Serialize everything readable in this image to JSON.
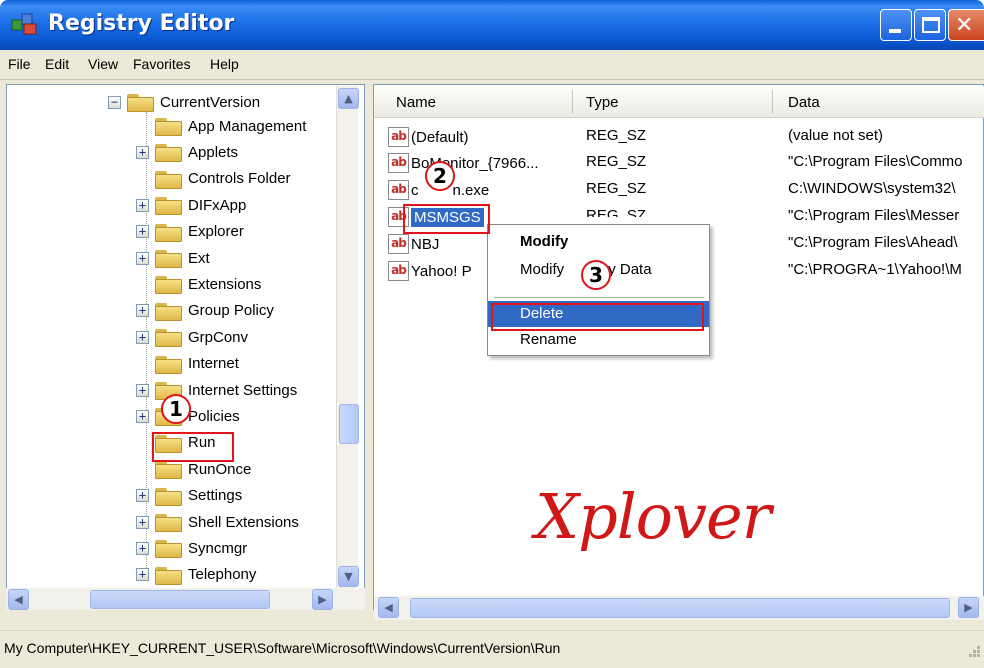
{
  "window": {
    "title": "Registry Editor"
  },
  "menu": [
    "File",
    "Edit",
    "View",
    "Favorites",
    "Help"
  ],
  "tree": {
    "items": [
      {
        "label": "CurrentVersion",
        "expander": "−"
      },
      {
        "label": "App Management",
        "expander": ""
      },
      {
        "label": "Applets",
        "expander": "+"
      },
      {
        "label": "Controls Folder",
        "expander": ""
      },
      {
        "label": "DIFxApp",
        "expander": "+"
      },
      {
        "label": "Explorer",
        "expander": "+"
      },
      {
        "label": "Ext",
        "expander": "+"
      },
      {
        "label": "Extensions",
        "expander": ""
      },
      {
        "label": "Group Policy",
        "expander": "+"
      },
      {
        "label": "GrpConv",
        "expander": "+"
      },
      {
        "label": "Internet",
        "expander": ""
      },
      {
        "label": "Internet Settings",
        "expander": "+"
      },
      {
        "label": "Policies",
        "expander": "+"
      },
      {
        "label": "Run",
        "expander": ""
      },
      {
        "label": "RunOnce",
        "expander": ""
      },
      {
        "label": "Settings",
        "expander": "+"
      },
      {
        "label": "Shell Extensions",
        "expander": "+"
      },
      {
        "label": "Syncmgr",
        "expander": "+"
      },
      {
        "label": "Telephony",
        "expander": "+"
      }
    ],
    "selected": "Run"
  },
  "list": {
    "columns": [
      "Name",
      "Type",
      "Data"
    ],
    "rows": [
      {
        "name": "(Default)",
        "type": "REG_SZ",
        "data": "(value not set)"
      },
      {
        "name": "BoMonitor_{7966...",
        "type": "REG_SZ",
        "data": "\"C:\\Program Files\\Commo"
      },
      {
        "name": "ctfmon.exe",
        "name_visible": "n.exe",
        "name_prefix": "c",
        "type": "REG_SZ",
        "data": "C:\\WINDOWS\\system32\\"
      },
      {
        "name": "MSMSGS",
        "type": "REG_SZ",
        "data": "\"C:\\Program Files\\Messer"
      },
      {
        "name": "NBJ",
        "type": "",
        "data": "\"C:\\Program Files\\Ahead\\"
      },
      {
        "name": "Yahoo! P...",
        "name_visible": "Yahoo! P",
        "type": "",
        "data": "\"C:\\PROGRA~1\\Yahoo!\\M"
      }
    ],
    "selected": "MSMSGS"
  },
  "context_menu": {
    "items": [
      "Modify",
      "Modify",
      "y Data",
      "Delete",
      "Rename"
    ],
    "highlighted": "Delete"
  },
  "callouts": [
    "1",
    "2",
    "3"
  ],
  "watermark": "Xplover",
  "status": "My Computer\\HKEY_CURRENT_USER\\Software\\Microsoft\\Windows\\CurrentVersion\\Run",
  "colors": {
    "accent": "#316ac5",
    "highlight_red": "#e0141a",
    "title_blue": "#0a58d0"
  }
}
